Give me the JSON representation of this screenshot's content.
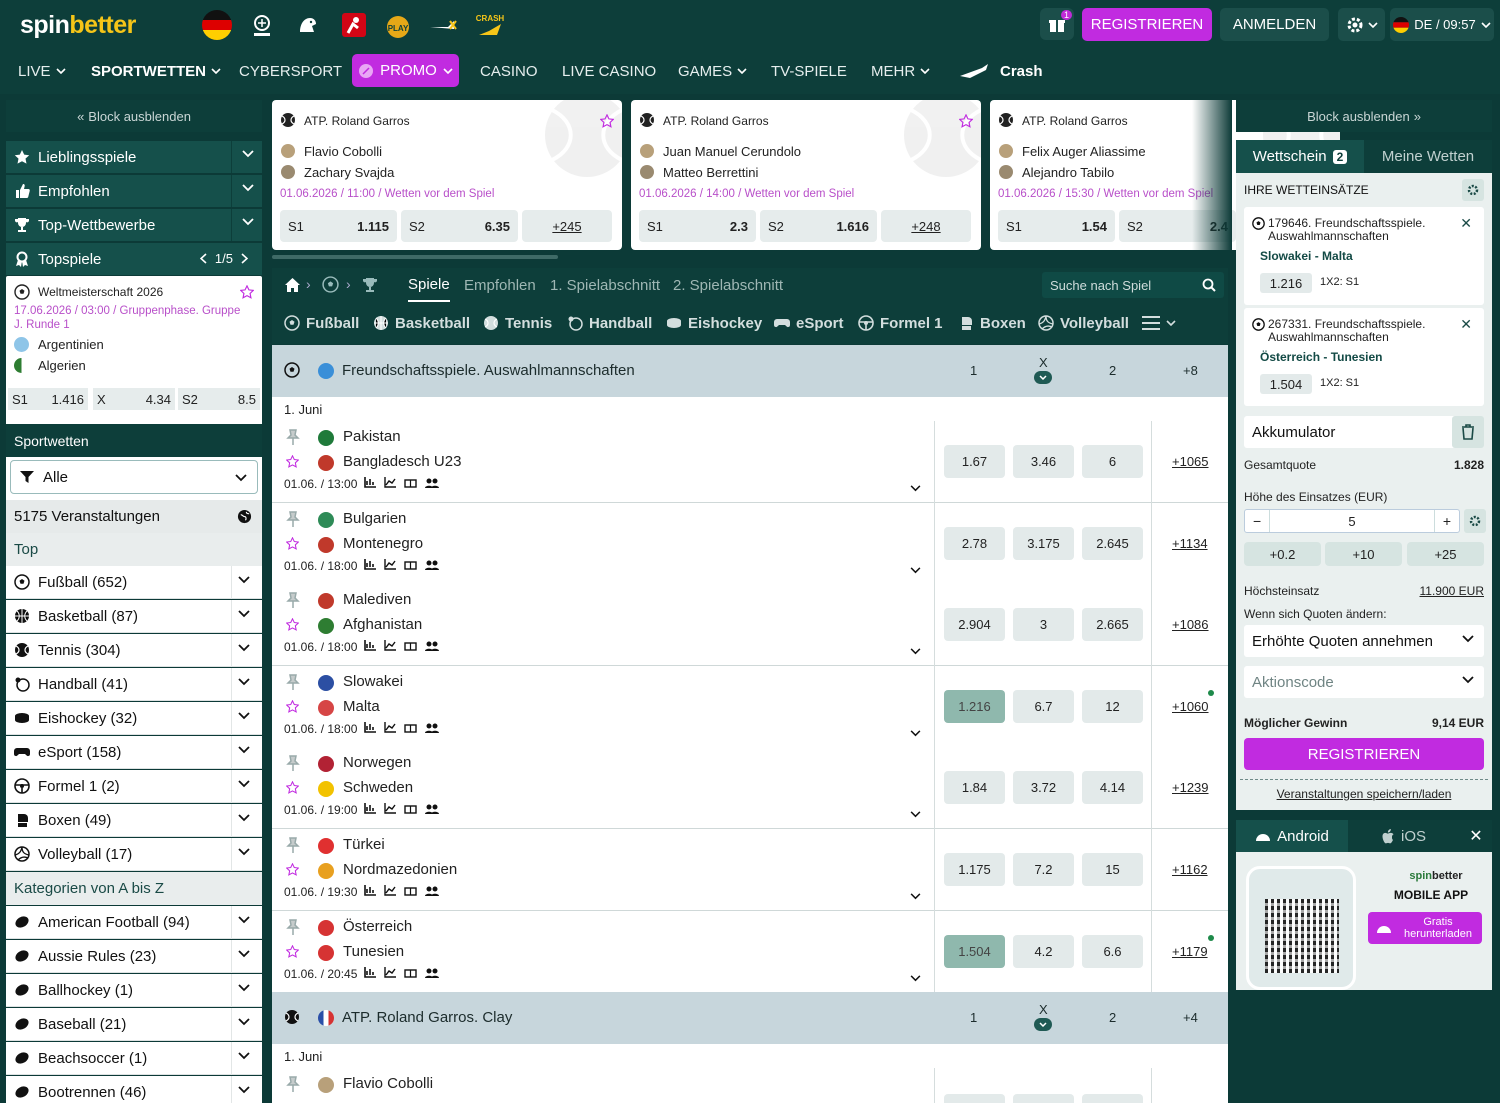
{
  "header": {
    "logo_a": "spin",
    "logo_b": "better",
    "gift_count": "1",
    "register": "REGISTRIEREN",
    "login": "ANMELDEN",
    "lang_time": "DE / 09:57",
    "partner_crash": "CRASH",
    "partner_play": "PLAY"
  },
  "nav": {
    "items": [
      "LIVE",
      "SPORTWETTEN",
      "CYBERSPORT",
      "PROMO",
      "CASINO",
      "LIVE CASINO",
      "GAMES",
      "TV-SPIELE",
      "MEHR",
      "Crash"
    ]
  },
  "left": {
    "hide_block": "Block ausblenden",
    "menu": [
      "Lieblingsspiele",
      "Empfohlen",
      "Top-Wettbewerbe",
      "Topspiele"
    ],
    "topspiele_pager": "1/5",
    "topcard": {
      "title": "Weltmeisterschaft 2026",
      "date": "17.06.2026 / 03:00 / Gruppenphase. Gruppe J. Runde 1",
      "team1": "Argentinien",
      "team2": "Algerien",
      "s1": "S1",
      "v1": "1.416",
      "x": "X",
      "vx": "4.34",
      "s2": "S2",
      "v2": "8.5"
    },
    "sportwetten": "Sportwetten",
    "filter": "Alle",
    "events_count": "5175 Veranstaltungen",
    "top": "Top",
    "sports": [
      "Fußball (652)",
      "Basketball (87)",
      "Tennis (304)",
      "Handball (41)",
      "Eishockey (32)",
      "eSport (158)",
      "Formel 1 (2)",
      "Boxen (49)",
      "Volleyball (17)"
    ],
    "cat_title": "Kategorien von A bis Z",
    "categories": [
      "American Football (94)",
      "Aussie Rules (23)",
      "Ballhockey (1)",
      "Baseball (21)",
      "Beachsoccer (1)",
      "Bootrennen (46)"
    ]
  },
  "featured": [
    {
      "league": "ATP. Roland Garros",
      "p1": "Flavio Cobolli",
      "p2": "Zachary Svajda",
      "date": "01.06.2026 / 11:00 / Wetten vor dem Spiel",
      "s1": "S1",
      "v1": "1.115",
      "s2": "S2",
      "v2": "6.35",
      "more": "+245"
    },
    {
      "league": "ATP. Roland Garros",
      "p1": "Juan Manuel Cerundolo",
      "p2": "Matteo Berrettini",
      "date": "01.06.2026 / 14:00 / Wetten vor dem Spiel",
      "s1": "S1",
      "v1": "2.3",
      "s2": "S2",
      "v2": "1.616",
      "more": "+248"
    },
    {
      "league": "ATP. Roland Garros",
      "p1": "Felix Auger Aliassime",
      "p2": "Alejandro Tabilo",
      "date": "01.06.2026 / 15:30 / Wetten vor dem Spiel",
      "s1": "S1",
      "v1": "1.54",
      "s2": "S2",
      "v2": "2.4"
    }
  ],
  "tabs": {
    "items": [
      "Spiele",
      "Empfohlen",
      "1. Spielabschnitt",
      "2. Spielabschnitt"
    ],
    "search_placeholder": "Suche nach Spiel"
  },
  "sporttabs": [
    "Fußball",
    "Basketball",
    "Tennis",
    "Handball",
    "Eishockey",
    "eSport",
    "Formel 1",
    "Boxen",
    "Volleyball"
  ],
  "leagues": [
    {
      "name": "Freundschaftsspiele. Auswahlmannschaften",
      "h1": "1",
      "hx": "X",
      "h2": "2",
      "more": "+8",
      "day": "1. Juni"
    },
    {
      "name": "ATP. Roland Garros. Clay",
      "h1": "1",
      "hx": "X",
      "h2": "2",
      "more": "+4",
      "day": "1. Juni"
    }
  ],
  "matches": [
    {
      "t1": "Pakistan",
      "t2": "Bangladesch U23",
      "time": "01.06. / 13:00",
      "o1": "1.67",
      "ox": "3.46",
      "o2": "6",
      "more": "+1065",
      "c1": "#1f7a3a",
      "c2": "#c0392b"
    },
    {
      "t1": "Bulgarien",
      "t2": "Montenegro",
      "time": "01.06. / 18:00",
      "o1": "2.78",
      "ox": "3.175",
      "o2": "2.645",
      "more": "+1134",
      "c1": "#2e8b57",
      "c2": "#c0392b"
    },
    {
      "t1": "Malediven",
      "t2": "Afghanistan",
      "time": "01.06. / 18:00",
      "o1": "2.904",
      "ox": "3",
      "o2": "2.665",
      "more": "+1086",
      "c1": "#c0392b",
      "c2": "#2e7d32"
    },
    {
      "t1": "Slowakei",
      "t2": "Malta",
      "time": "01.06. / 18:00",
      "o1": "1.216",
      "ox": "6.7",
      "o2": "12",
      "more": "+1060",
      "c1": "#2c4fa3",
      "c2": "#d64545"
    },
    {
      "t1": "Norwegen",
      "t2": "Schweden",
      "time": "01.06. / 19:00",
      "o1": "1.84",
      "ox": "3.72",
      "o2": "4.14",
      "more": "+1239",
      "c1": "#b22234",
      "c2": "#f2c200"
    },
    {
      "t1": "Türkei",
      "t2": "Nordmazedonien",
      "time": "01.06. / 19:30",
      "o1": "1.175",
      "ox": "7.2",
      "o2": "15",
      "more": "+1162",
      "c1": "#e03030",
      "c2": "#e8a020"
    },
    {
      "t1": "Österreich",
      "t2": "Tunesien",
      "time": "01.06. / 20:45",
      "o1": "1.504",
      "ox": "4.2",
      "o2": "6.6",
      "more": "+1179",
      "c1": "#d63333",
      "c2": "#d63333"
    }
  ],
  "match_last": {
    "t1": "Flavio Cobolli"
  },
  "slip": {
    "hide_block": "Block ausblenden",
    "tab1": "Wettschein",
    "tab1_count": "2",
    "tab2": "Meine Wetten",
    "title": "IHRE WETTEINSÄTZE",
    "bets": [
      {
        "event": "179646. Freundschaftsspiele. Auswahlmannschaften",
        "match": "Slowakei - Malta",
        "odd": "1.216",
        "market": "1X2: S1"
      },
      {
        "event": "267331. Freundschaftsspiele. Auswahlmannschaften",
        "match": "Österreich - Tunesien",
        "odd": "1.504",
        "market": "1X2: S1"
      }
    ],
    "type": "Akkumulator",
    "total_label": "Gesamtquote",
    "total_value": "1.828",
    "stake_label": "Höhe des Einsatzes (EUR)",
    "stake_value": "5",
    "quick": [
      "+0.2",
      "+10",
      "+25"
    ],
    "max_label": "Höchsteinsatz",
    "max_value": "11.900 EUR",
    "change_label": "Wenn sich Quoten ändern:",
    "change_value": "Erhöhte Quoten annehmen",
    "promo_placeholder": "Aktionscode",
    "win_label": "Möglicher Gewinn",
    "win_value": "9,14 EUR",
    "register": "REGISTRIEREN",
    "save": "Veranstaltungen speichern/laden"
  },
  "app": {
    "android": "Android",
    "ios": "iOS",
    "brand_a": "spin",
    "brand_b": "better",
    "mobile": "MOBILE APP",
    "download": "Gratis herunterladen"
  }
}
